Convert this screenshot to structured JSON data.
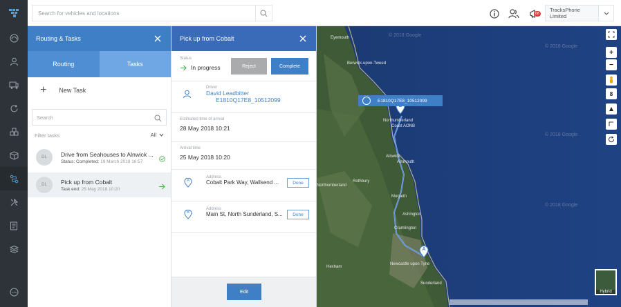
{
  "topbar": {
    "search_placeholder": "Search for vehicles and locations",
    "company": "TracksPhone Limited",
    "notification_badge": "68"
  },
  "panel_routing": {
    "title": "Routing & Tasks",
    "tabs": [
      "Routing",
      "Tasks"
    ],
    "new_task": "New Task",
    "search_placeholder": "Search",
    "filter_label": "Filter tasks",
    "filter_value": "All",
    "tasks": [
      {
        "initials": "DL",
        "title": "Drive from Seahouses to Alnwick ...",
        "sub_label": "Status: Completed:",
        "sub_value": "19 March 2018 16:57"
      },
      {
        "initials": "DL",
        "title": "Pick up from Cobalt",
        "sub_label": "Task end:",
        "sub_value": "25 May 2018 10:20"
      }
    ]
  },
  "panel_detail": {
    "title": "Pick up from Cobalt",
    "status_label": "Status",
    "status_value": "In progress",
    "reject": "Reject",
    "complete": "Complete",
    "driver_label": "Driver",
    "driver_name": "David Leadbitter",
    "driver_vehicle": "E1810Q17E8_10512099",
    "eta_label": "Estimated time of arrival",
    "eta_value": "28 May 2018 10:21",
    "arrival_label": "Arrival time",
    "arrival_value": "25 May 2018 10:20",
    "addresses": [
      {
        "marker": "A",
        "label": "Address",
        "value": "Cobalt Park Way, Wallsend ...",
        "action": "Done"
      },
      {
        "marker": "B",
        "label": "Address",
        "value": "Main St, North Sunderland, S...",
        "action": "Done"
      }
    ],
    "edit": "Edit"
  },
  "map": {
    "vehicle_label": "E1810Q17E8_10512099",
    "hybrid_label": "Hybrid",
    "marker_a": "A",
    "marker_b": "B",
    "places": [
      {
        "name": "Eyemouth",
        "cls": "p1"
      },
      {
        "name": "Berwick-upon-Tweed",
        "cls": "p2"
      },
      {
        "name": "Northumberland",
        "cls": "p3"
      },
      {
        "name": "Coast AONB",
        "cls": "p4"
      },
      {
        "name": "Alnwick",
        "cls": "p5"
      },
      {
        "name": "Alnmouth",
        "cls": "p6"
      },
      {
        "name": "Rothbury",
        "cls": "p7"
      },
      {
        "name": "Northumberland",
        "cls": "p8"
      },
      {
        "name": "Morpeth",
        "cls": "p9"
      },
      {
        "name": "Ashington",
        "cls": "p10"
      },
      {
        "name": "Cramlington",
        "cls": "p11"
      },
      {
        "name": "Newcastle upon Tyne",
        "cls": "p12"
      },
      {
        "name": "Sunderland",
        "cls": "p13"
      },
      {
        "name": "Hexham",
        "cls": "p14"
      }
    ],
    "watermarks": [
      "© 2018 Google",
      "© 2018 Google",
      "© 2018 Google",
      "© 2018 Google"
    ]
  }
}
